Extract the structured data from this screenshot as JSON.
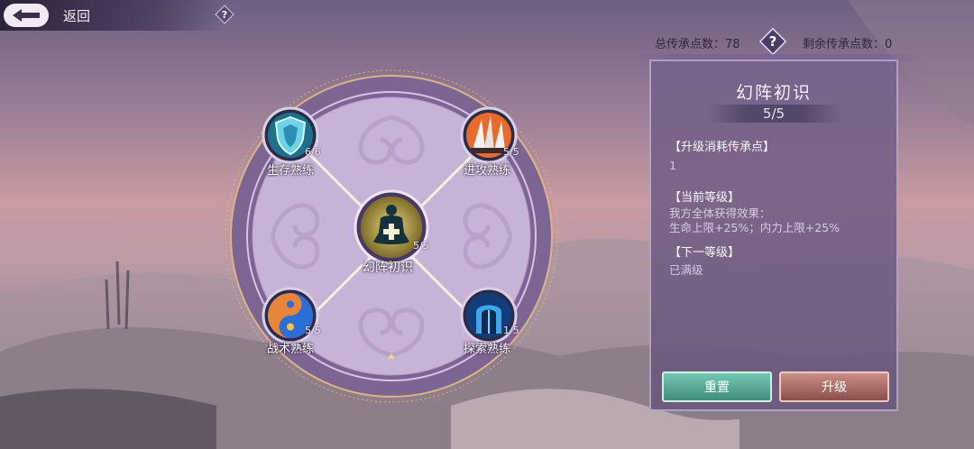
{
  "header": {
    "back_label": "返回",
    "help_icon": "question-icon"
  },
  "points": {
    "total": "总传承点数：78",
    "remaining": "剩余传承点数：0"
  },
  "wheel": {
    "nodes": [
      {
        "id": "survival",
        "label": "生存熟练",
        "level": "6/6",
        "icon": "shield-icon"
      },
      {
        "id": "attack",
        "label": "进攻熟练",
        "level": "5/5",
        "icon": "blades-icon"
      },
      {
        "id": "tactics",
        "label": "战术熟练",
        "level": "5/5",
        "icon": "yin-yang-icon"
      },
      {
        "id": "explore",
        "label": "探索熟练",
        "level": "1/5",
        "icon": "gate-icon"
      }
    ],
    "center": {
      "label": "幻阵初识",
      "level": "5/5",
      "icon": "meditation-icon"
    }
  },
  "panel": {
    "title": "幻阵初识",
    "level": "5/5",
    "cost_head": "【升级消耗传承点】",
    "cost_value": "1",
    "current_head": "【当前等级】",
    "current_line1": "我方全体获得效果：",
    "current_line2": "生命上限+25%；内力上限+25%",
    "next_head": "【下一等级】",
    "next_value": "已满级",
    "reset_label": "重置",
    "upgrade_label": "升级"
  },
  "colors": {
    "reset": "#4fa592",
    "upgrade": "#a4605a",
    "panel": "#76628a",
    "ring": "#7d6593"
  }
}
